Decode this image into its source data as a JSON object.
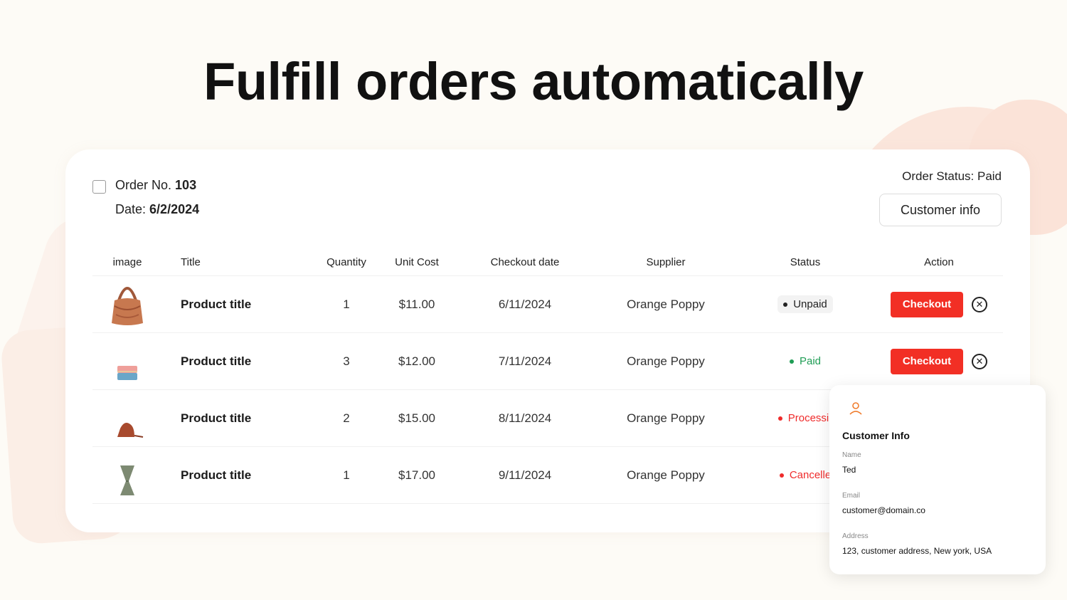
{
  "headline": "Fulfill orders automatically",
  "order": {
    "number_label": "Order No.",
    "number": "103",
    "date_label": "Date:",
    "date": "6/2/2024",
    "status_text": "Order Status: Paid",
    "customer_button": "Customer info"
  },
  "table": {
    "headers": [
      "image",
      "Title",
      "Quantity",
      "Unit Cost",
      "Checkout date",
      "Supplier",
      "Status",
      "Action"
    ],
    "rows": [
      {
        "image": "handbag-brown",
        "title": "Product title",
        "quantity": "1",
        "unit_cost": "$11.00",
        "checkout_date": "6/11/2024",
        "supplier": "Orange Poppy",
        "status": "Unpaid",
        "action": "Checkout"
      },
      {
        "image": "pouch-pink-blue",
        "title": "Product title",
        "quantity": "3",
        "unit_cost": "$12.00",
        "checkout_date": "7/11/2024",
        "supplier": "Orange Poppy",
        "status": "Paid",
        "action": "Checkout"
      },
      {
        "image": "bag-rust",
        "title": "Product title",
        "quantity": "2",
        "unit_cost": "$15.00",
        "checkout_date": "8/11/2024",
        "supplier": "Orange Poppy",
        "status": "Processir"
      },
      {
        "image": "vase-green",
        "title": "Product title",
        "quantity": "1",
        "unit_cost": "$17.00",
        "checkout_date": "9/11/2024",
        "supplier": "Orange Poppy",
        "status": "Cancelle"
      }
    ]
  },
  "customer_info": {
    "title": "Customer Info",
    "name_label": "Name",
    "name": "Ted",
    "email_label": "Email",
    "email": "customer@domain.co",
    "address_label": "Address",
    "address": "123, customer address, New york, USA"
  },
  "colors": {
    "accent": "#f22f25",
    "paid": "#1f9d55",
    "background": "#fdfbf6"
  },
  "icons": [
    "user-icon",
    "close-circle-icon"
  ]
}
